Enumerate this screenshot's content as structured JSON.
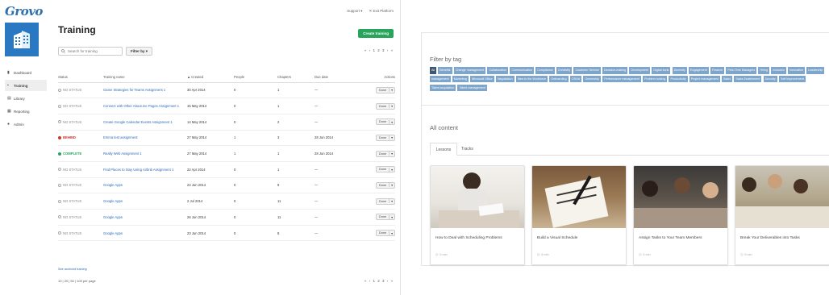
{
  "app": {
    "logo": "Grovo",
    "topbar": {
      "support": "Support ▾",
      "exit": "✕ Exit Platform"
    }
  },
  "sidebar": {
    "items": [
      {
        "label": "Dashboard",
        "icon": "bar-chart-icon"
      },
      {
        "label": "Training",
        "icon": "document-icon"
      },
      {
        "label": "Library",
        "icon": "book-icon"
      },
      {
        "label": "Reporting",
        "icon": "report-icon"
      },
      {
        "label": "Admin",
        "icon": "user-icon"
      }
    ]
  },
  "main": {
    "title": "Training",
    "create_label": "Create training",
    "search_placeholder": "Search for training",
    "filter_label": "Filter by ▾",
    "pager": "« ‹ 1 2 3 › »",
    "columns": [
      "Status",
      "Training name",
      "▲ Created",
      "People",
      "Chapters",
      "Due date",
      "Actions"
    ],
    "rows": [
      {
        "status": "NO STATUS",
        "name": "Game Strategies for Teams Assignment 1",
        "created": "30 Apr 2014",
        "people": "0",
        "chapters": "1",
        "due": "—",
        "action": "Done"
      },
      {
        "status": "NO STATUS",
        "name": "Connect with Other About.me Pages Assignment 1",
        "created": "15 May 2014",
        "people": "0",
        "chapters": "1",
        "due": "—",
        "action": "Done"
      },
      {
        "status": "NO STATUS",
        "name": "Create Google Calendar Events Assignment 1",
        "created": "14 May 2014",
        "people": "0",
        "chapters": "2",
        "due": "—",
        "action": "Done"
      },
      {
        "status": "BEHIND",
        "name": "Emma test assignment",
        "created": "27 May 2014",
        "people": "1",
        "chapters": "3",
        "due": "28 Jun 2014",
        "action": "Done"
      },
      {
        "status": "COMPLETE",
        "name": "Really Web Assignment 1",
        "created": "27 May 2014",
        "people": "1",
        "chapters": "1",
        "due": "28 Jun 2014",
        "action": "Done"
      },
      {
        "status": "NO STATUS",
        "name": "Find Places to Stay Using Airbnb Assignment 1",
        "created": "22 Apr 2014",
        "people": "0",
        "chapters": "1",
        "due": "—",
        "action": "Done"
      },
      {
        "status": "NO STATUS",
        "name": "Google Apps",
        "created": "24 Jun 2014",
        "people": "0",
        "chapters": "9",
        "due": "—",
        "action": "Done"
      },
      {
        "status": "NO STATUS",
        "name": "Google Apps",
        "created": "2 Jul 2014",
        "people": "0",
        "chapters": "11",
        "due": "—",
        "action": "Done"
      },
      {
        "status": "NO STATUS",
        "name": "Google Apps",
        "created": "26 Jun 2014",
        "people": "0",
        "chapters": "11",
        "due": "—",
        "action": "Done"
      },
      {
        "status": "NO STATUS",
        "name": "Google Apps",
        "created": "23 Jun 2014",
        "people": "0",
        "chapters": "8",
        "due": "—",
        "action": "Done"
      }
    ],
    "see_archived": "See archived training",
    "per_page": "10 | 20 | 50 | 100 per page",
    "pager_bottom": "« ‹ 1 2 3 › »"
  },
  "library": {
    "filter_title": "Filter by tag",
    "tags": [
      "All",
      "Benefits",
      "Change management",
      "Collaboration",
      "Communication",
      "Compliance",
      "Creativity",
      "Customer Service",
      "Decision-making",
      "Development",
      "Digital tools",
      "Diversity",
      "Engagement",
      "Finance",
      "First-Time Managers",
      "Hiring",
      "Inclusion",
      "Innovation",
      "Leadership",
      "management",
      "Marketing",
      "Microsoft Office",
      "Negotiation",
      "New to the Workforce",
      "Onboarding",
      "OSHA",
      "Ownership",
      "Performance management",
      "Problem solving",
      "Productivity",
      "Project management",
      "Sales",
      "Sales Enablement",
      "Security",
      "Self Improvement",
      "Talent acquisition",
      "Talent management"
    ],
    "all_content": "All content",
    "tabs": [
      "Lessons",
      "Tracks"
    ],
    "cards": [
      {
        "title": "How to Deal with Scheduling Problems",
        "meta": "5 min"
      },
      {
        "title": "Build a Visual Schedule",
        "meta": "6 min"
      },
      {
        "title": "Assign Tasks to Your Team Members",
        "meta": "5 min"
      },
      {
        "title": "Break Your Deliverables into Tasks",
        "meta": "5 min"
      }
    ]
  },
  "colors": {
    "accent": "#2b78c2",
    "create": "#27a55a",
    "behind": "#d0342c",
    "tag": "#7ea6cc",
    "tag_active": "#3f5674"
  }
}
